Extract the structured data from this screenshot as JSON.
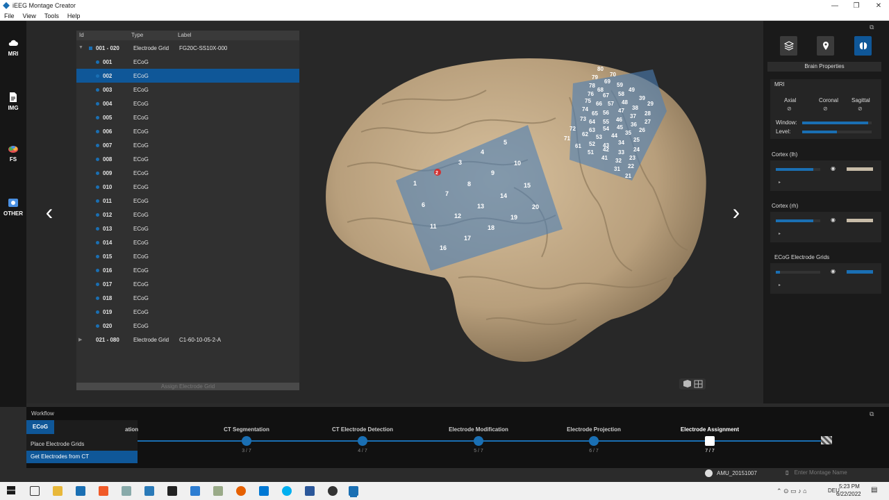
{
  "window": {
    "title": "iEEG Montage Creator"
  },
  "menu": [
    "File",
    "View",
    "Tools",
    "Help"
  ],
  "sidebar": [
    {
      "label": "MRI",
      "icon": "cloud-icon"
    },
    {
      "label": "IMG",
      "icon": "document-icon"
    },
    {
      "label": "FS",
      "icon": "brain-icon"
    },
    {
      "label": "OTHER",
      "icon": "image-icon"
    }
  ],
  "tree": {
    "headers": {
      "id": "Id",
      "type": "Type",
      "label": "Label"
    },
    "groups": [
      {
        "id": "001 - 020",
        "type": "Electrode Grid",
        "label": "FG20C-SS10X-000"
      },
      {
        "id": "021 - 080",
        "type": "Electrode Grid",
        "label": "C1-60-10-05-2-A"
      }
    ],
    "rows": [
      {
        "id": "001",
        "type": "ECoG"
      },
      {
        "id": "002",
        "type": "ECoG"
      },
      {
        "id": "003",
        "type": "ECoG"
      },
      {
        "id": "004",
        "type": "ECoG"
      },
      {
        "id": "005",
        "type": "ECoG"
      },
      {
        "id": "006",
        "type": "ECoG"
      },
      {
        "id": "007",
        "type": "ECoG"
      },
      {
        "id": "008",
        "type": "ECoG"
      },
      {
        "id": "009",
        "type": "ECoG"
      },
      {
        "id": "010",
        "type": "ECoG"
      },
      {
        "id": "011",
        "type": "ECoG"
      },
      {
        "id": "012",
        "type": "ECoG"
      },
      {
        "id": "013",
        "type": "ECoG"
      },
      {
        "id": "014",
        "type": "ECoG"
      },
      {
        "id": "015",
        "type": "ECoG"
      },
      {
        "id": "016",
        "type": "ECoG"
      },
      {
        "id": "017",
        "type": "ECoG"
      },
      {
        "id": "018",
        "type": "ECoG"
      },
      {
        "id": "019",
        "type": "ECoG"
      },
      {
        "id": "020",
        "type": "ECoG"
      }
    ],
    "selected_row": "002",
    "assign_button": "Assign Electrode Grid"
  },
  "electrodes_grid1": [
    "1",
    "2",
    "3",
    "4",
    "5",
    "6",
    "7",
    "8",
    "9",
    "10",
    "11",
    "12",
    "13",
    "14",
    "15",
    "16",
    "17",
    "18",
    "19",
    "20"
  ],
  "electrodes_grid2_numbers": [
    "80",
    "79",
    "78",
    "70",
    "69",
    "68",
    "76",
    "67",
    "59",
    "58",
    "49",
    "75",
    "66",
    "57",
    "48",
    "39",
    "74",
    "65",
    "56",
    "47",
    "38",
    "29",
    "73",
    "64",
    "55",
    "46",
    "37",
    "28",
    "63",
    "54",
    "45",
    "36",
    "27",
    "72",
    "62",
    "53",
    "44",
    "35",
    "26",
    "61",
    "52",
    "43",
    "34",
    "25",
    "71",
    "51",
    "42",
    "33",
    "24",
    "41",
    "32",
    "23",
    "31",
    "22",
    "21"
  ],
  "right_panel": {
    "title": "Brain Properties",
    "mri": {
      "label": "MRI",
      "views": [
        "Axial",
        "Coronal",
        "Sagittal"
      ],
      "window_label": "Window:",
      "level_label": "Level:",
      "window_value": 0.95,
      "level_value": 0.5
    },
    "cortex_lh": {
      "label": "Cortex (lh)",
      "value": 0.85
    },
    "cortex_rh": {
      "label": "Cortex (rh)",
      "value": 0.85
    },
    "ecog": {
      "label": "ECoG Electrode Grids",
      "value": 0.1
    }
  },
  "workflow": {
    "title": "Workflow",
    "menu_header": "ECoG",
    "menu_items": [
      "Place Electrode Grids",
      "Get Electrodes from CT"
    ],
    "steps": [
      {
        "label": "ation",
        "count": ""
      },
      {
        "label": "CT Segmentation",
        "count": "3 / 7"
      },
      {
        "label": "CT Electrode Detection",
        "count": "4 / 7"
      },
      {
        "label": "Electrode Modification",
        "count": "5 / 7"
      },
      {
        "label": "Electrode Projection",
        "count": "6 / 7"
      },
      {
        "label": "Electrode Assignment",
        "count": "7 / 7"
      }
    ],
    "user": "AMU_20151007",
    "montage_placeholder": "Enter Montage Name"
  },
  "taskbar": {
    "time": "5:23 PM",
    "date": "6/22/2022",
    "lang": "DEU"
  },
  "colors": {
    "accent": "#0f5798",
    "electrode": "#1a6fb3",
    "brain": "#c7ae8a"
  }
}
